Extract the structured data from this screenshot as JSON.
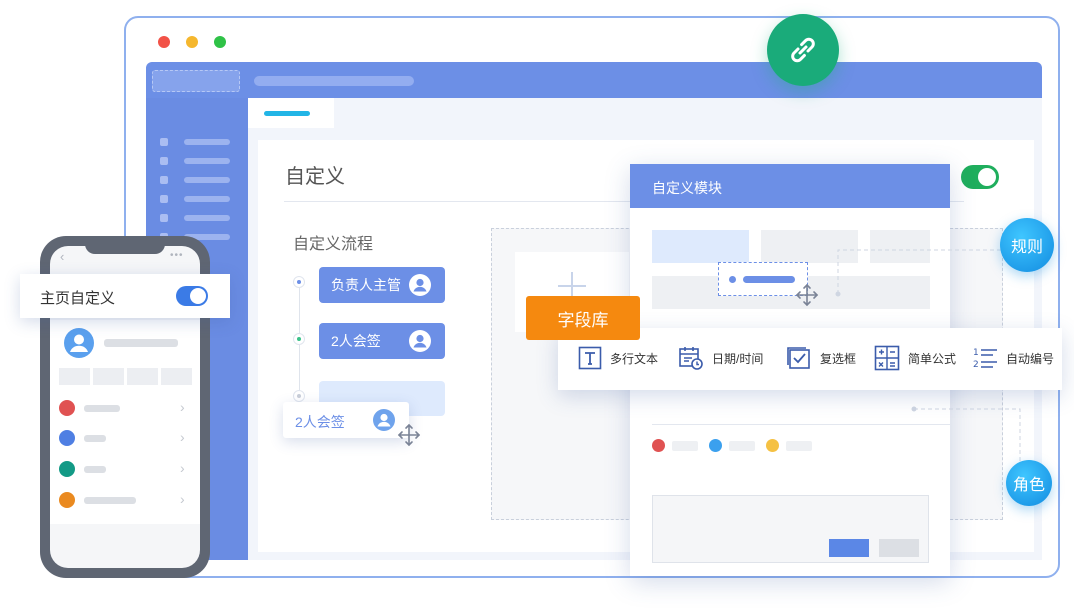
{
  "main": {
    "title": "自定义",
    "flow": {
      "title": "自定义流程",
      "nodes": [
        "负责人主管",
        "2人会签"
      ],
      "dragging_node": "2人会签"
    }
  },
  "module_panel": {
    "title": "自定义模块"
  },
  "field_library": {
    "label": "字段库",
    "items": [
      "多行文本",
      "日期/时间",
      "复选框",
      "简单公式",
      "自动编号"
    ]
  },
  "bubbles": {
    "rules": "规则",
    "roles": "角色"
  },
  "phone": {
    "homepage_custom": "主页自定义"
  },
  "colors": {
    "accent": "#6c8fe6",
    "toggle_green": "#1fae5d",
    "orange": "#f5890f",
    "link_green": "#1aab7a"
  }
}
